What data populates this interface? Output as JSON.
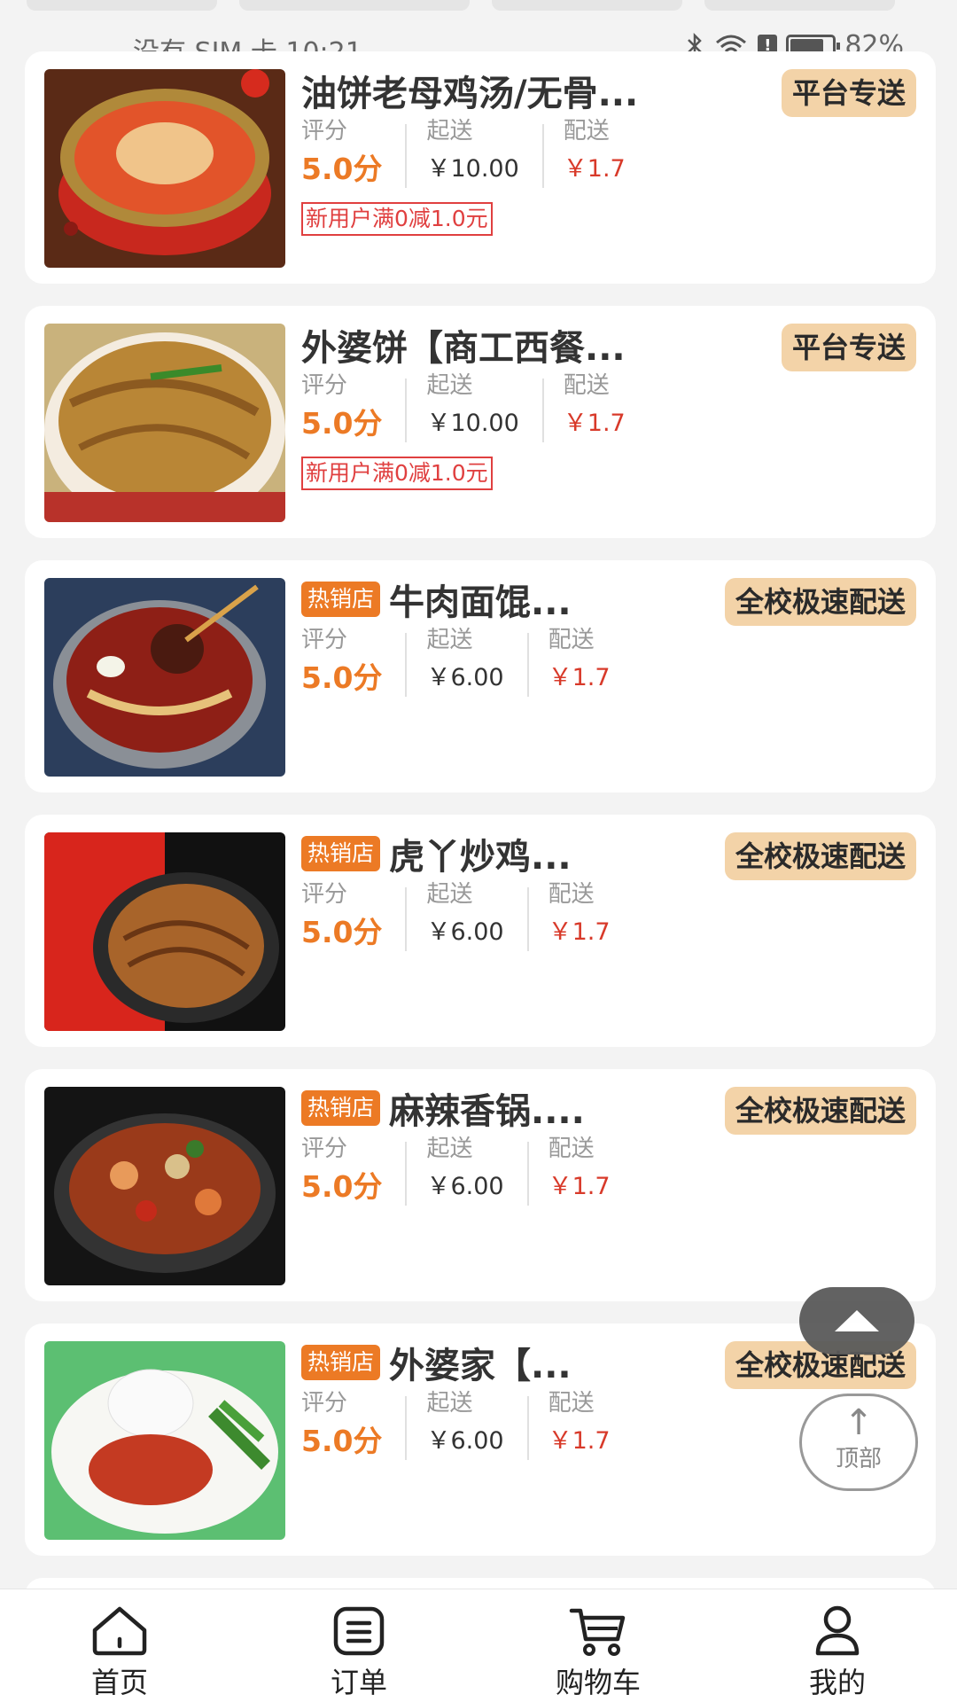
{
  "status_bar": {
    "carrier_time": "没有 SIM 卡 10:21",
    "battery": "82%",
    "battery_level": 0.82,
    "icons": [
      "bluetooth-icon",
      "wifi-icon",
      "alert-icon",
      "battery-icon"
    ]
  },
  "labels": {
    "rating": "评分",
    "min_order": "起送",
    "delivery": "配送",
    "hot_tag": "热销店"
  },
  "stores": [
    {
      "name": "油饼老母鸡汤/无骨...",
      "badge": "平台专送",
      "rating": "5.0分",
      "min_order": "￥10.00",
      "delivery_fee": "￥1.7",
      "promo": "新用户满0减1.0元",
      "hot": false,
      "image": "chicken-soup-photo"
    },
    {
      "name": "外婆饼【商工西餐...",
      "badge": "平台专送",
      "rating": "5.0分",
      "min_order": "￥10.00",
      "delivery_fee": "￥1.7",
      "promo": "新用户满0减1.0元",
      "hot": false,
      "image": "noodles-photo"
    },
    {
      "name": "牛肉面馄...",
      "badge": "全校极速配送",
      "rating": "5.0分",
      "min_order": "￥6.00",
      "delivery_fee": "￥1.7",
      "promo": "",
      "hot": true,
      "image": "beef-noodle-photo"
    },
    {
      "name": "虎丫炒鸡...",
      "badge": "全校极速配送",
      "rating": "5.0分",
      "min_order": "￥6.00",
      "delivery_fee": "￥1.7",
      "promo": "",
      "hot": true,
      "image": "fried-noodles-photo"
    },
    {
      "name": "麻辣香锅....",
      "badge": "全校极速配送",
      "rating": "5.0分",
      "min_order": "￥6.00",
      "delivery_fee": "￥1.7",
      "promo": "",
      "hot": true,
      "image": "spicy-pot-photo"
    },
    {
      "name": "外婆家【...",
      "badge": "全校极速配送",
      "rating": "5.0分",
      "min_order": "￥6.00",
      "delivery_fee": "￥1.7",
      "promo": "",
      "hot": true,
      "image": "rice-plate-photo"
    }
  ],
  "fab": {
    "up_icon": "chevron-up-icon",
    "top_arrow": "↑",
    "top_label": "顶部"
  },
  "nav": {
    "items": [
      {
        "label": "首页",
        "icon": "home-icon"
      },
      {
        "label": "订单",
        "icon": "order-icon"
      },
      {
        "label": "购物车",
        "icon": "cart-icon"
      },
      {
        "label": "我的",
        "icon": "profile-icon"
      }
    ]
  },
  "colors": {
    "accent": "#ec7a25",
    "badge_bg": "#f3d3a8",
    "price_red": "#d83a2a",
    "promo_red": "#e04040"
  }
}
